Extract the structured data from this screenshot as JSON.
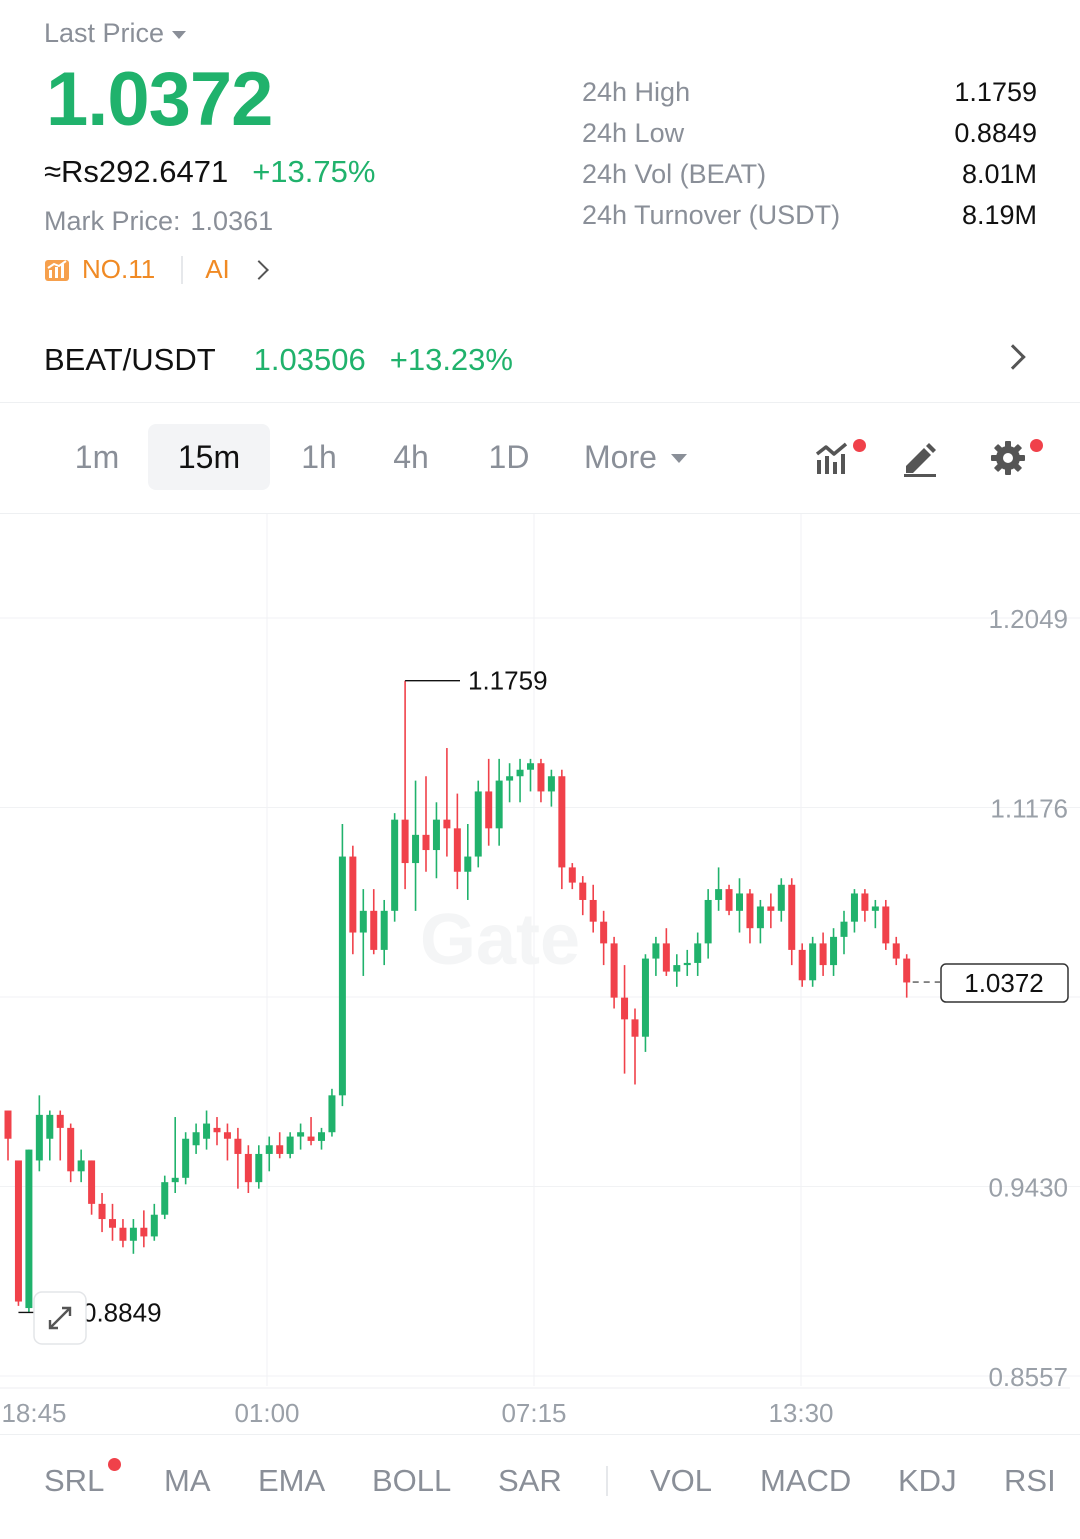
{
  "header": {
    "last_price_label": "Last Price",
    "last_price": "1.0372",
    "fiat_price": "≈Rs292.6471",
    "change_pct": "+13.75%",
    "mark_price_label": "Mark Price:",
    "mark_price": "1.0361",
    "rank": "NO.11",
    "ai_label": "AI"
  },
  "stats": [
    {
      "label": "24h High",
      "value": "1.1759"
    },
    {
      "label": "24h Low",
      "value": "0.8849"
    },
    {
      "label": "24h Vol (BEAT)",
      "value": "8.01M"
    },
    {
      "label": "24h Turnover (USDT)",
      "value": "8.19M"
    }
  ],
  "pair": {
    "name": "BEAT/USDT",
    "price": "1.03506",
    "change": "+13.23%"
  },
  "timeframes": [
    "1m",
    "15m",
    "1h",
    "4h",
    "1D"
  ],
  "timeframe_active": "15m",
  "more_label": "More",
  "tools": [
    "indicator-chart-icon",
    "draw-pen-icon",
    "gear-icon"
  ],
  "colors": {
    "up": "#20b26c",
    "down": "#f0414a",
    "rank": "#f08a24"
  },
  "chart_data": {
    "type": "candlestick",
    "y_ticks": [
      "1.2049",
      "1.1176",
      "0.9430",
      "0.8557"
    ],
    "y_tick_values": [
      1.2049,
      1.1176,
      0.943,
      0.8557
    ],
    "x_ticks": [
      "18:45",
      "01:00",
      "07:15",
      "13:30"
    ],
    "high_label": "1.1759",
    "low_label": "0.8849",
    "current_price_label": "1.0372",
    "current_price": 1.0372,
    "candles": [
      [
        0.978,
        0.978,
        0.955,
        0.965
      ],
      [
        0.955,
        0.955,
        0.888,
        0.89
      ],
      [
        0.887,
        0.96,
        0.885,
        0.96
      ],
      [
        0.955,
        0.985,
        0.95,
        0.976
      ],
      [
        0.965,
        0.978,
        0.955,
        0.976
      ],
      [
        0.976,
        0.978,
        0.955,
        0.97
      ],
      [
        0.97,
        0.972,
        0.945,
        0.95
      ],
      [
        0.95,
        0.96,
        0.945,
        0.955
      ],
      [
        0.955,
        0.955,
        0.93,
        0.935
      ],
      [
        0.935,
        0.94,
        0.922,
        0.928
      ],
      [
        0.928,
        0.935,
        0.918,
        0.924
      ],
      [
        0.924,
        0.928,
        0.915,
        0.918
      ],
      [
        0.918,
        0.928,
        0.912,
        0.924
      ],
      [
        0.924,
        0.932,
        0.915,
        0.92
      ],
      [
        0.92,
        0.935,
        0.918,
        0.93
      ],
      [
        0.93,
        0.948,
        0.928,
        0.945
      ],
      [
        0.945,
        0.975,
        0.94,
        0.947
      ],
      [
        0.947,
        0.968,
        0.944,
        0.965
      ],
      [
        0.962,
        0.972,
        0.958,
        0.968
      ],
      [
        0.965,
        0.978,
        0.96,
        0.972
      ],
      [
        0.97,
        0.975,
        0.962,
        0.968
      ],
      [
        0.968,
        0.972,
        0.955,
        0.965
      ],
      [
        0.965,
        0.97,
        0.942,
        0.958
      ],
      [
        0.958,
        0.962,
        0.94,
        0.945
      ],
      [
        0.945,
        0.962,
        0.942,
        0.958
      ],
      [
        0.958,
        0.966,
        0.95,
        0.962
      ],
      [
        0.962,
        0.968,
        0.956,
        0.958
      ],
      [
        0.958,
        0.968,
        0.956,
        0.966
      ],
      [
        0.966,
        0.972,
        0.96,
        0.968
      ],
      [
        0.966,
        0.975,
        0.962,
        0.964
      ],
      [
        0.964,
        0.97,
        0.96,
        0.968
      ],
      [
        0.968,
        0.988,
        0.966,
        0.985
      ],
      [
        0.985,
        1.11,
        0.98,
        1.095
      ],
      [
        1.095,
        1.1,
        1.05,
        1.06
      ],
      [
        1.06,
        1.08,
        1.04,
        1.07
      ],
      [
        1.07,
        1.08,
        1.05,
        1.052
      ],
      [
        1.052,
        1.075,
        1.045,
        1.07
      ],
      [
        1.07,
        1.115,
        1.065,
        1.112
      ],
      [
        1.112,
        1.176,
        1.08,
        1.092
      ],
      [
        1.092,
        1.13,
        1.07,
        1.105
      ],
      [
        1.105,
        1.132,
        1.088,
        1.098
      ],
      [
        1.098,
        1.12,
        1.085,
        1.112
      ],
      [
        1.112,
        1.145,
        1.095,
        1.108
      ],
      [
        1.108,
        1.124,
        1.08,
        1.088
      ],
      [
        1.088,
        1.11,
        1.075,
        1.095
      ],
      [
        1.095,
        1.13,
        1.09,
        1.125
      ],
      [
        1.125,
        1.14,
        1.1,
        1.108
      ],
      [
        1.108,
        1.14,
        1.1,
        1.13
      ],
      [
        1.13,
        1.138,
        1.12,
        1.132
      ],
      [
        1.132,
        1.14,
        1.12,
        1.135
      ],
      [
        1.135,
        1.14,
        1.125,
        1.138
      ],
      [
        1.138,
        1.14,
        1.12,
        1.125
      ],
      [
        1.125,
        1.135,
        1.118,
        1.132
      ],
      [
        1.132,
        1.135,
        1.08,
        1.09
      ],
      [
        1.09,
        1.092,
        1.08,
        1.083
      ],
      [
        1.083,
        1.086,
        1.068,
        1.075
      ],
      [
        1.075,
        1.082,
        1.06,
        1.065
      ],
      [
        1.065,
        1.07,
        1.045,
        1.055
      ],
      [
        1.055,
        1.058,
        1.025,
        1.03
      ],
      [
        1.03,
        1.045,
        0.995,
        1.02
      ],
      [
        1.02,
        1.025,
        0.99,
        1.012
      ],
      [
        1.012,
        1.05,
        1.005,
        1.048
      ],
      [
        1.048,
        1.058,
        1.04,
        1.055
      ],
      [
        1.055,
        1.062,
        1.04,
        1.042
      ],
      [
        1.042,
        1.05,
        1.035,
        1.045
      ],
      [
        1.045,
        1.052,
        1.04,
        1.046
      ],
      [
        1.046,
        1.06,
        1.04,
        1.055
      ],
      [
        1.055,
        1.08,
        1.048,
        1.075
      ],
      [
        1.075,
        1.09,
        1.07,
        1.08
      ],
      [
        1.08,
        1.082,
        1.068,
        1.07
      ],
      [
        1.07,
        1.085,
        1.06,
        1.078
      ],
      [
        1.078,
        1.08,
        1.055,
        1.062
      ],
      [
        1.062,
        1.075,
        1.055,
        1.072
      ],
      [
        1.072,
        1.078,
        1.062,
        1.07
      ],
      [
        1.07,
        1.085,
        1.065,
        1.082
      ],
      [
        1.082,
        1.085,
        1.045,
        1.052
      ],
      [
        1.052,
        1.055,
        1.035,
        1.038
      ],
      [
        1.038,
        1.058,
        1.035,
        1.055
      ],
      [
        1.055,
        1.06,
        1.04,
        1.045
      ],
      [
        1.045,
        1.062,
        1.04,
        1.058
      ],
      [
        1.058,
        1.07,
        1.05,
        1.065
      ],
      [
        1.065,
        1.08,
        1.06,
        1.078
      ],
      [
        1.078,
        1.08,
        1.065,
        1.07
      ],
      [
        1.07,
        1.075,
        1.062,
        1.072
      ],
      [
        1.072,
        1.075,
        1.052,
        1.055
      ],
      [
        1.055,
        1.058,
        1.045,
        1.048
      ],
      [
        1.048,
        1.05,
        1.03,
        1.037
      ]
    ]
  },
  "indicators_main": [
    "SRL",
    "MA",
    "EMA",
    "BOLL",
    "SAR"
  ],
  "indicators_sub": [
    "VOL",
    "MACD",
    "KDJ",
    "RSI"
  ]
}
